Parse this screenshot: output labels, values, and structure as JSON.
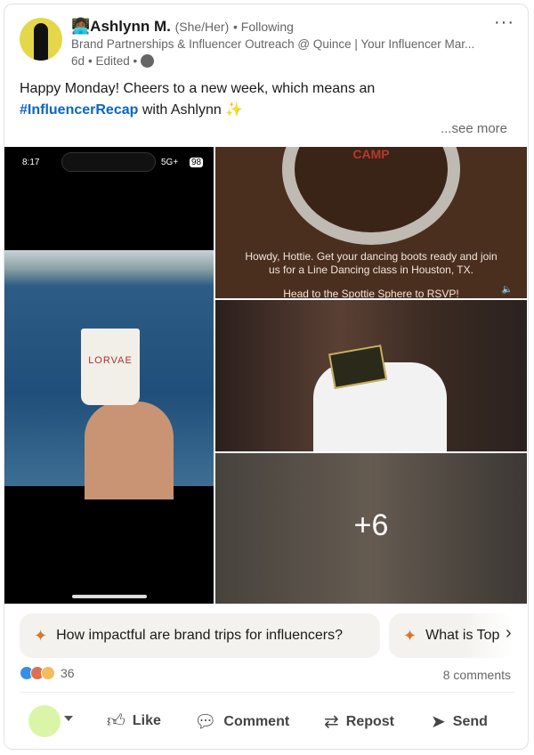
{
  "post": {
    "author": {
      "emoji": "👩🏾‍💻",
      "name": "Ashlynn M.",
      "pronouns": "(She/Her)",
      "following": "• Following",
      "headline": "Brand Partnerships & Influencer Outreach @ Quince | Your Influencer Mar...",
      "time": "6d",
      "edited": "• Edited •",
      "visibility_icon": "globe-icon"
    },
    "more_label": "···",
    "text_line1": "Happy Monday! Cheers to a new week, which means an",
    "hashtag": "#InfluencerRecap",
    "text_line2": " with Ashlynn ✨",
    "see_more": "...see more"
  },
  "media": {
    "phone": {
      "time": "8:17",
      "network": "5G+",
      "battery": "98",
      "cup_brand": "LORVAE"
    },
    "promo": {
      "camp": "CAMP",
      "text": "Howdy, Hottie. Get your dancing boots ready and join us for a Line Dancing class in Houston, TX.",
      "rsvp": "Head to the Spottie Sphere to RSVP!"
    },
    "more_count": "+6"
  },
  "suggestions": [
    {
      "icon": "sparkle-icon",
      "label": "How impactful are brand trips for influencers?"
    },
    {
      "icon": "sparkle-icon",
      "label": "What is Top"
    }
  ],
  "social": {
    "reaction_count": "36",
    "comments": "8 comments",
    "reaction_colors": [
      "#378fe9",
      "#df704d",
      "#f5bb5c"
    ]
  },
  "actions": {
    "like": "Like",
    "comment": "Comment",
    "repost": "Repost",
    "send": "Send"
  }
}
